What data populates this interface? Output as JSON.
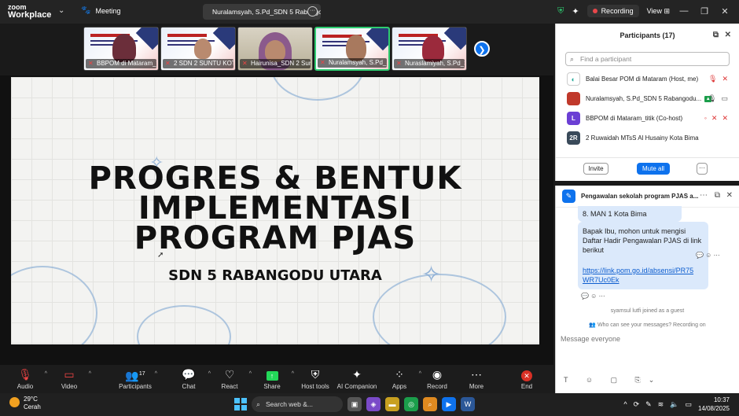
{
  "topbar": {
    "brand_line1": "zoom",
    "brand_line2": "Workplace",
    "meeting_label": "Meeting",
    "share_tab_label": "Nuralamsyah, S.Pd_SDN 5 Rabangodu",
    "recording_label": "Recording",
    "view_label": "View"
  },
  "thumbnails": [
    {
      "name": "BBPOM di Mataram_titik"
    },
    {
      "name": "2 SDN 2 SUNTU KOTA..."
    },
    {
      "name": "Hairunisa_SDN 2 Suntu"
    },
    {
      "name": "Nuralamsyah, S.Pd_SDN 5..."
    },
    {
      "name": "Nuraslamiyah, S.Pd_SDN..."
    }
  ],
  "slide": {
    "title_line1": "PROGRES & BENTUK",
    "title_line2": "IMPLEMENTASI",
    "title_line3": "PROGRAM PJAS",
    "subtitle": "SDN 5 RABANGODU UTARA"
  },
  "toolbar": {
    "audio": "Audio",
    "video": "Video",
    "participants": "Participants",
    "participants_count": "17",
    "chat": "Chat",
    "react": "React",
    "share": "Share",
    "host_tools": "Host tools",
    "ai_companion": "AI Companion",
    "apps": "Apps",
    "record": "Record",
    "more": "More",
    "end": "End"
  },
  "participants_panel": {
    "title": "Participants (17)",
    "search_placeholder": "Find a participant",
    "rows": [
      {
        "initials": "",
        "name": "Balai Besar POM di Mataram (Host, me)",
        "color": "#ffffff"
      },
      {
        "initials": "",
        "name": "Nuralamsyah, S.Pd_SDN 5 Rabangodu...",
        "color": "#c0392b"
      },
      {
        "initials": "L",
        "name": "BBPOM di Mataram_titik (Co-host)",
        "color": "#6b3fd4"
      },
      {
        "initials": "2R",
        "name": "2 Ruwaidah MTsS Al Husainy Kota Bima",
        "color": "#3a4a5a"
      }
    ],
    "invite": "Invite",
    "mute_all": "Mute all",
    "more": "···"
  },
  "chat_panel": {
    "title": "Pengawalan sekolah program PJAS a...",
    "msg0": "8. MAN 1 Kota Bima",
    "msg1_line1": "Bapak Ibu, mohon untuk mengisi",
    "msg1_line2": "Daftar Hadir Pengawalan PJAS di link",
    "msg1_line3": "berikut",
    "link_line1": "https://link.pom.go.id/absensi/PR75",
    "link_line2": "WR7Uc0Ek",
    "system_msg": "syamsul lutfi joined as a guest",
    "visibility_note": "Who can see your messages? Recording on",
    "input_placeholder": "Message everyone"
  },
  "taskbar": {
    "temp": "29°C",
    "weather": "Cerah",
    "search": "Search web &...",
    "time": "10:37",
    "date": "14/08/2025"
  },
  "colors": {
    "zoom_blue": "#0e72ed",
    "recording_red": "#e8474a",
    "share_green": "#23d959",
    "end_red": "#d93025"
  }
}
